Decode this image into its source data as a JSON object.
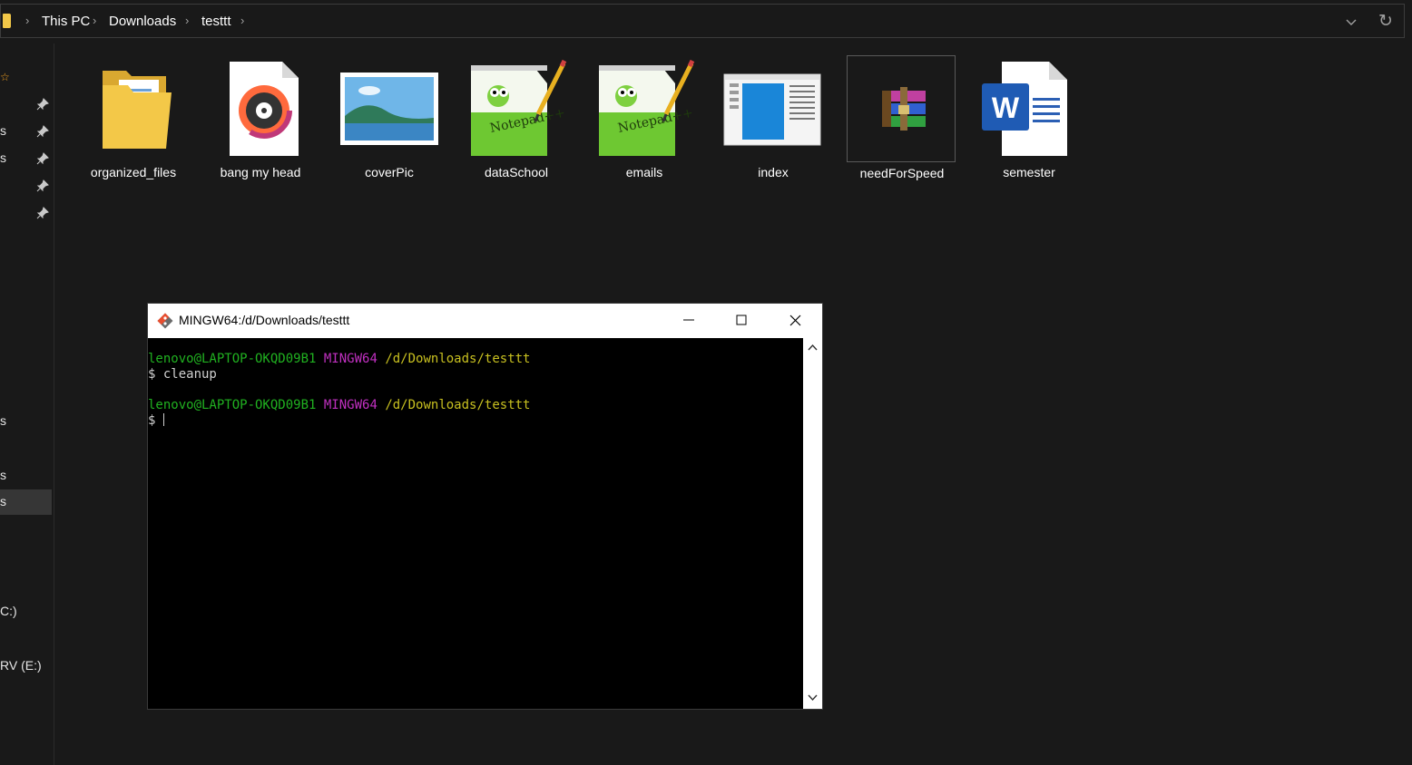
{
  "breadcrumb": [
    {
      "label": "This PC"
    },
    {
      "label": "Downloads"
    },
    {
      "label": "testtt"
    }
  ],
  "nav_fragments": [
    {
      "text": "s"
    },
    {
      "text": "s"
    },
    {
      "text": "s"
    },
    {
      "text": "s"
    },
    {
      "text": "s"
    },
    {
      "text": "C:)"
    },
    {
      "text": "RV (E:)"
    }
  ],
  "files": [
    {
      "name": "organized_files",
      "icon": "folder-icon"
    },
    {
      "name": "bang my head",
      "icon": "audio-file-icon"
    },
    {
      "name": "coverPic",
      "icon": "image-file-icon"
    },
    {
      "name": "dataSchool",
      "icon": "notepadpp-file-icon"
    },
    {
      "name": "emails",
      "icon": "notepadpp-file-icon"
    },
    {
      "name": "index",
      "icon": "html-file-icon"
    },
    {
      "name": "needForSpeed",
      "icon": "winrar-archive-icon"
    },
    {
      "name": "semester",
      "icon": "word-document-icon"
    }
  ],
  "terminal": {
    "title": "MINGW64:/d/Downloads/testtt",
    "lines": [
      {
        "user": "lenovo@LAPTOP-OKQD09B1",
        "env": "MINGW64",
        "path": "/d/Downloads/testtt"
      },
      {
        "prompt": "$ cleanup"
      },
      {
        "user": "lenovo@LAPTOP-OKQD09B1",
        "env": "MINGW64",
        "path": "/d/Downloads/testtt"
      },
      {
        "prompt": "$ "
      }
    ]
  },
  "colors": {
    "background": "#191919",
    "term_user": "#20b120",
    "term_env": "#c030c0",
    "term_path": "#c8c020",
    "folder": "#f3c848"
  }
}
